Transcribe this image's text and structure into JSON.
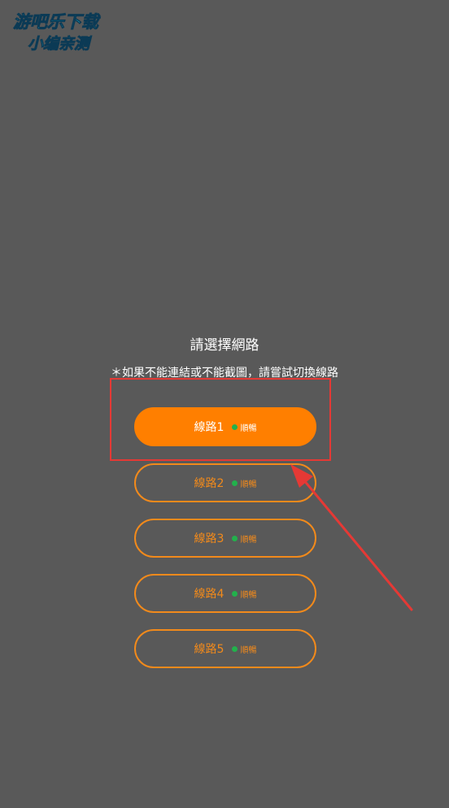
{
  "watermark": {
    "line1": "游吧乐下载",
    "line2": "小编亲测"
  },
  "dialog": {
    "title": "請選擇網路",
    "hint": "＊如果不能連結或不能截圖，請嘗試切換線路"
  },
  "lines": [
    {
      "label": "線路1",
      "status": "順暢"
    },
    {
      "label": "線路2",
      "status": "順暢"
    },
    {
      "label": "線路3",
      "status": "順暢"
    },
    {
      "label": "線路4",
      "status": "順暢"
    },
    {
      "label": "線路5",
      "status": "順暢"
    }
  ],
  "colors": {
    "background": "#595959",
    "accent": "#ff7f00",
    "status_dot": "#22b14c",
    "annotation": "#e53935"
  }
}
